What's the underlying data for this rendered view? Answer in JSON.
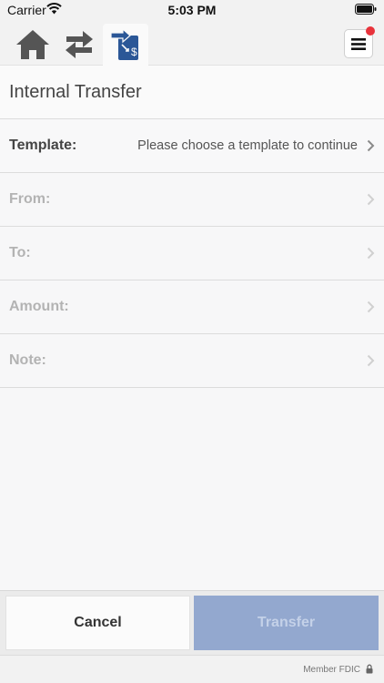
{
  "status_bar": {
    "carrier": "Carrier",
    "time": "5:03 PM",
    "icons": [
      "wifi-icon",
      "battery-icon"
    ]
  },
  "toolbar": {
    "items": [
      {
        "icon": "home-icon",
        "active": false
      },
      {
        "icon": "transfers-icon",
        "active": false
      },
      {
        "icon": "internal-transfer-icon",
        "active": true
      }
    ],
    "menu": {
      "icon": "hamburger-menu-icon",
      "badge_color": "#e8333b"
    }
  },
  "page": {
    "title": "Internal Transfer"
  },
  "form": {
    "template": {
      "label": "Template:",
      "value": "Please choose a template to continue"
    },
    "from": {
      "label": "From:"
    },
    "to": {
      "label": "To:"
    },
    "amount": {
      "label": "Amount:"
    },
    "note": {
      "label": "Note:"
    }
  },
  "actions": {
    "cancel_label": "Cancel",
    "transfer_label": "Transfer"
  },
  "footer": {
    "text": "Member FDIC",
    "icon": "lock-icon"
  },
  "colors": {
    "accent": "#2b5797",
    "disabled_button": "#93a8cf",
    "icon_gray": "#555555"
  }
}
